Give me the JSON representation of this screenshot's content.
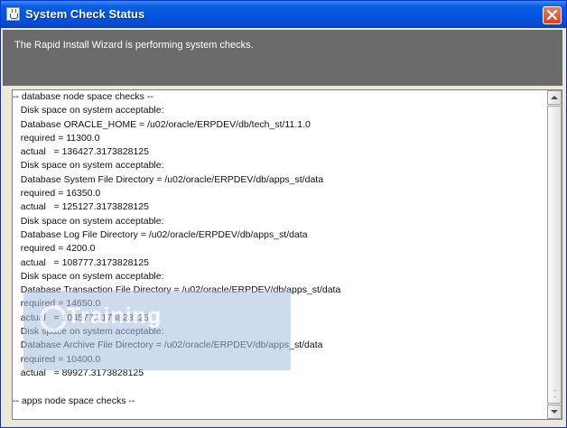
{
  "window": {
    "title": "System Check Status",
    "icon": "java-icon",
    "close_icon": "close-icon"
  },
  "header": {
    "message": "The Rapid Install Wizard is performing system checks."
  },
  "log": {
    "lines": [
      "-- database node space checks --",
      "   Disk space on system acceptable:",
      "   Database ORACLE_HOME = /u02/oracle/ERPDEV/db/tech_st/11.1.0",
      "   required = 11300.0",
      "   actual   = 136427.3173828125",
      "   Disk space on system acceptable:",
      "   Database System File Directory = /u02/oracle/ERPDEV/db/apps_st/data",
      "   required = 16350.0",
      "   actual   = 125127.3173828125",
      "   Disk space on system acceptable:",
      "   Database Log File Directory = /u02/oracle/ERPDEV/db/apps_st/data",
      "   required = 4200.0",
      "   actual   = 108777.3173828125",
      "   Disk space on system acceptable:",
      "   Database Transaction File Directory = /u02/oracle/ERPDEV/db/apps_st/data",
      "   required = 14650.0",
      "   actual   = 104577.3173828125",
      "   Disk space on system acceptable:",
      "   Database Archive File Directory = /u02/oracle/ERPDEV/db/apps_st/data",
      "   required = 10400.0",
      "   actual   = 89927.3173828125",
      "",
      "-- apps node space checks --"
    ]
  },
  "watermark": {
    "text": "Training"
  },
  "colors": {
    "titlebar": "#0054e3",
    "header_bg": "#6b6b6b",
    "close_button": "#d7421d"
  }
}
